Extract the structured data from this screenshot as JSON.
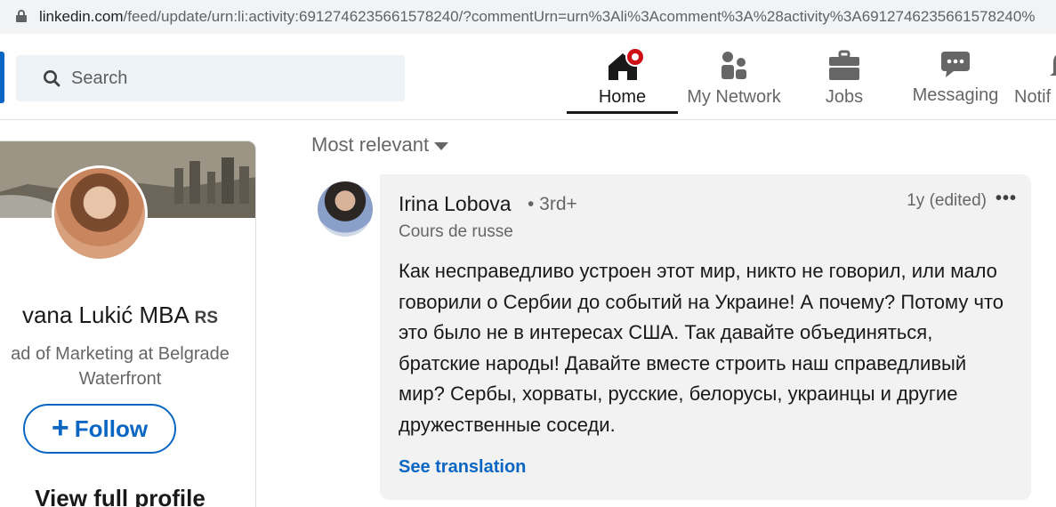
{
  "browser": {
    "url_host": "linkedin.com",
    "url_path": "/feed/update/urn:li:activity:6912746235661578240/?commentUrn=urn%3Ali%3Acomment%3A%28activity%3A6912746235661578240%"
  },
  "search": {
    "placeholder": "Search"
  },
  "nav": {
    "items": [
      {
        "label": "Home",
        "icon": "home-icon",
        "active": true
      },
      {
        "label": "My Network",
        "icon": "network-icon"
      },
      {
        "label": "Jobs",
        "icon": "briefcase-icon"
      },
      {
        "label": "Messaging",
        "icon": "messaging-icon"
      },
      {
        "label": "Notif",
        "icon": "bell-icon"
      }
    ]
  },
  "profile_card": {
    "name": "vana Lukić MBA",
    "country": "RS",
    "headline": "ad of Marketing at Belgrade Waterfront",
    "follow_label": "Follow",
    "view_profile_label": "View full profile"
  },
  "sort": {
    "label": "Most relevant"
  },
  "comment": {
    "author": "Irina Lobova",
    "degree": "• 3rd+",
    "headline": "Cours de russe",
    "time": "1y (edited)",
    "more": "•••",
    "text": "Как несправедливо устроен этот мир, никто не говорил, или мало говорили о Сербии до событий на Украине! А почему? Потому что это было не в интересах США. Так давайте объединяться, братские народы! Давайте вместе строить наш справедливый мир? Сербы, хорваты, русские, белорусы, украинцы и другие дружественные соседи.",
    "translate_label": "See translation"
  },
  "colors": {
    "accent": "#0a66c2",
    "notification": "#cc1016"
  }
}
